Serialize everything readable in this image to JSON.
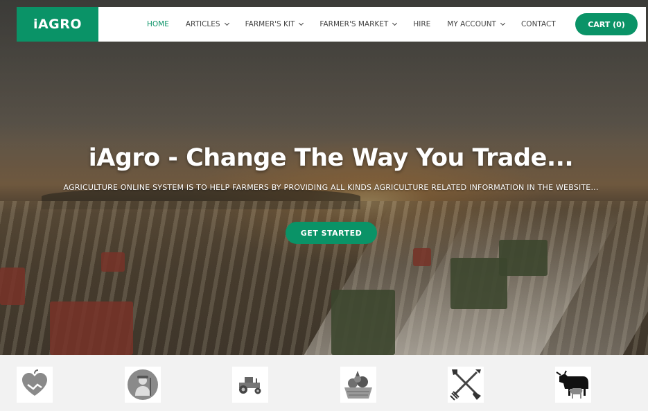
{
  "header": {
    "logo_text": "iAGRO",
    "nav": [
      {
        "label": "HOME",
        "active": true,
        "dropdown": false
      },
      {
        "label": "ARTICLES",
        "active": false,
        "dropdown": true
      },
      {
        "label": "FARMER'S KIT",
        "active": false,
        "dropdown": true
      },
      {
        "label": "FARMER'S MARKET",
        "active": false,
        "dropdown": true
      },
      {
        "label": "HIRE",
        "active": false,
        "dropdown": false
      },
      {
        "label": "MY ACCOUNT",
        "active": false,
        "dropdown": true
      },
      {
        "label": "CONTACT",
        "active": false,
        "dropdown": false
      }
    ],
    "cart_label": "CART (0)"
  },
  "hero": {
    "title": "iAgro - Change The Way You Trade...",
    "subtitle": "AGRICULTURE ONLINE SYSTEM IS TO HELP FARMERS BY PROVIDING ALL KINDS AGRICULTURE RELATED INFORMATION IN THE WEBSITE...",
    "cta_label": "GET STARTED"
  },
  "categories": [
    {
      "icon": "heart-handshake-icon"
    },
    {
      "icon": "farmer-icon"
    },
    {
      "icon": "tractor-icon"
    },
    {
      "icon": "produce-basket-icon"
    },
    {
      "icon": "crossed-tools-icon"
    },
    {
      "icon": "livestock-icon"
    }
  ],
  "colors": {
    "brand_green": "#0a9367",
    "nav_text": "#444444",
    "strip_bg": "#f2f2f2"
  }
}
